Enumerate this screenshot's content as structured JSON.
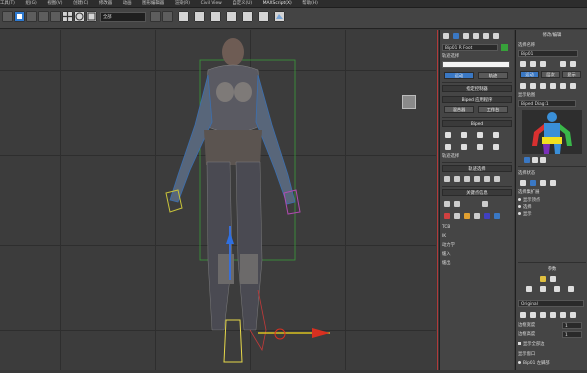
{
  "menubar": {
    "items": [
      "工具(T)",
      "组(G)",
      "视图(V)",
      "创建(C)",
      "修改器",
      "动画",
      "图形编辑器",
      "渲染(R)",
      "Civil View",
      "自定义(U)",
      "MAXScript(X)",
      "帮助(H)"
    ]
  },
  "toolbar": {
    "selection_filter": "全部",
    "view_dropdown": "视图"
  },
  "command_panel": {
    "object_name": "Bip01 R Foot",
    "object_color": "#37a13a",
    "rollout_title": "指定控制器",
    "track_selection": "轨迹选择",
    "tab_left": "运动",
    "tab_right": "轨迹",
    "biped_section": "Biped",
    "figure_mode": "体形模式",
    "footstep_mode": "足迹模式",
    "biped_apps": "Biped 应用程序",
    "mixer": "混合器",
    "workbench": "工作台",
    "keyframe_tools": "关键点信息",
    "key_info": "轨迹选择",
    "copy_paste": "复制/粘贴",
    "tcb": "TCB",
    "ik": "IK",
    "dynamics_label": "动力学",
    "ease_to": "缓入",
    "ease_from": "缓出"
  },
  "modify_panel": {
    "tab_modify": "修改/编辑",
    "name_label": "选择名称",
    "object_list": "Bip01",
    "tab_a": "运动",
    "tab_b": "层次",
    "tab_c": "显示",
    "map_label": "显示贴图",
    "map_dropdown": "Biped Diag:1",
    "status_label": "选择状态",
    "grow_label": "选择集扩展",
    "sel_object_label": "选择对象",
    "radio1": "显示顶点",
    "radio2": "选择",
    "radio3": "显示",
    "params_label": "参数",
    "param_field": "Original",
    "weight_label": "权重影响",
    "spin1_label": "边框宽度",
    "spin1_value": "1",
    "spin2_label": "边框高度",
    "spin2_value": "1",
    "check_label": "显示全部边",
    "list_label": "显示窗口",
    "list_item": "Bip01 左脚部"
  }
}
